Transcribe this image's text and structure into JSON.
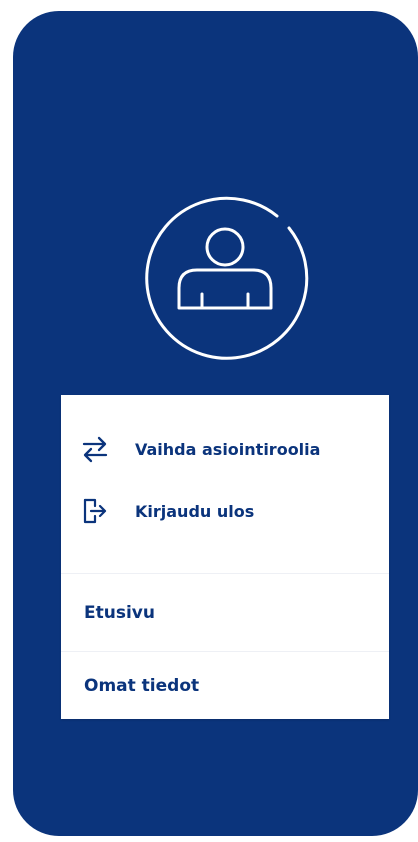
{
  "profile": {
    "avatar_icon": "user-icon"
  },
  "menu": {
    "actions": [
      {
        "label": "Vaihda asiointiroolia",
        "icon": "swap-arrows-icon"
      },
      {
        "label": "Kirjaudu ulos",
        "icon": "logout-door-icon"
      }
    ],
    "nav": [
      {
        "label": "Etusivu"
      },
      {
        "label": "Omat tiedot"
      }
    ]
  },
  "colors": {
    "frame_background": "#0b347c",
    "card_background": "#ffffff",
    "text_primary": "#0b347c",
    "divider": "#eef0f5"
  }
}
